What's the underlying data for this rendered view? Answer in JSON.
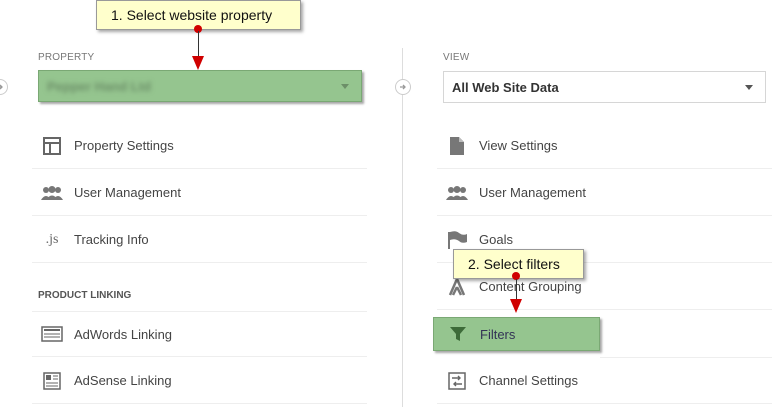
{
  "property_column": {
    "label": "PROPERTY",
    "selected_property": "Pepper Hand Ltd",
    "items": [
      {
        "label": "Property Settings",
        "icon": "window-icon"
      },
      {
        "label": "User Management",
        "icon": "users-icon"
      },
      {
        "label": "Tracking Info",
        "icon": "js-icon"
      }
    ],
    "product_linking_header": "PRODUCT LINKING",
    "linking_items": [
      {
        "label": "AdWords Linking",
        "icon": "adwords-icon"
      },
      {
        "label": "AdSense Linking",
        "icon": "adsense-icon"
      }
    ]
  },
  "view_column": {
    "label": "VIEW",
    "selected_view": "All Web Site Data",
    "items": [
      {
        "label": "View Settings",
        "icon": "document-icon"
      },
      {
        "label": "User Management",
        "icon": "users-icon"
      },
      {
        "label": "Goals",
        "icon": "flag-icon"
      },
      {
        "label": "Content Grouping",
        "icon": "content-grouping-icon"
      },
      {
        "label": "Filters",
        "icon": "funnel-icon"
      },
      {
        "label": "Channel Settings",
        "icon": "channel-settings-icon"
      }
    ]
  },
  "callouts": {
    "step1": "1. Select website property",
    "step2": "2. Select filters"
  },
  "colors": {
    "highlight_green": "#95c58f",
    "callout_yellow": "#ffffcc",
    "arrow_red": "#d00000"
  }
}
